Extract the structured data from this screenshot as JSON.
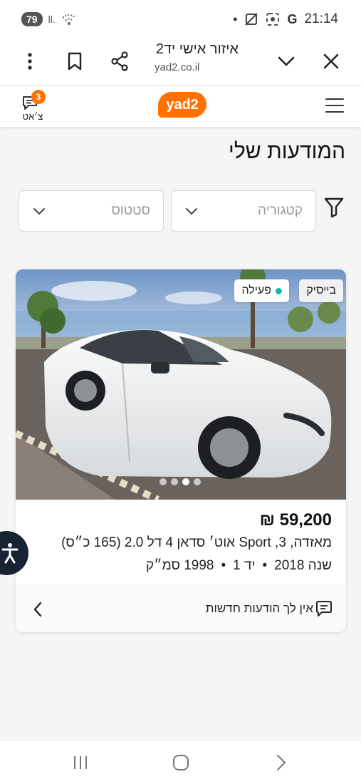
{
  "status_bar": {
    "battery": "79",
    "signal_glyph": "ll.",
    "time": "21:14",
    "icons": [
      "dot-icon",
      "mute-icon",
      "screenshot-icon",
      "google-icon"
    ]
  },
  "browser": {
    "title": "איזור אישי יד2",
    "url": "yad2.co.il"
  },
  "site_header": {
    "chat_label": "צ׳אט",
    "chat_badge_count": "3",
    "logo_text": "yad2"
  },
  "page": {
    "title": "המודעות שלי"
  },
  "filters": {
    "category_placeholder": "קטגוריה",
    "status_placeholder": "סטטוס"
  },
  "ad": {
    "badge_basic": "בייסיק",
    "badge_status": "פעילה",
    "price": "59,200 ₪",
    "title": "מאזדה, 3, Sport אוט׳ סדאן 4 דל 2.0 (165 כ״ס)",
    "meta": {
      "year": "שנה 2018",
      "hand": "יד 1",
      "engine": "1998 סמ״ק"
    },
    "image_dots": {
      "count": 4,
      "active_index": 2
    },
    "messages_text": "אין לך הודעות חדשות"
  },
  "colors": {
    "brand_orange": "#ff7100",
    "status_teal": "#14b8a6",
    "a11y_navy": "#172233"
  }
}
